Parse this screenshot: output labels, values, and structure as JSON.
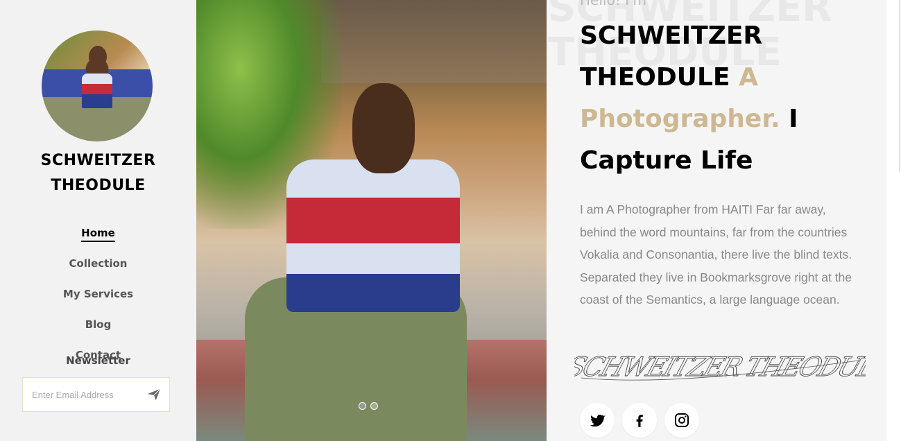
{
  "sidebar": {
    "site_name": "SCHWEITZER THEODULE",
    "nav": [
      {
        "label": "Home",
        "active": true
      },
      {
        "label": "Collection",
        "active": false
      },
      {
        "label": "My Services",
        "active": false
      },
      {
        "label": "Blog",
        "active": false
      },
      {
        "label": "Contact",
        "active": false
      }
    ],
    "newsletter": {
      "title": "Newsletter",
      "placeholder": "Enter Email Address",
      "submit_icon": "paper-plane-icon"
    }
  },
  "hero": {
    "slides": 2,
    "active_slide": 1
  },
  "intro": {
    "watermark": "SCHWEITZER THEODULE",
    "greeting": "Hello! I'm",
    "name": "SCHWEITZER THEODULE",
    "role": "A Photographer.",
    "tagline": "I Capture Life",
    "bio": "I am A Photographer from HAITI Far far away, behind the word mountains, far from the countries Vokalia and Consonantia, there live the blind texts. Separated they live in Bookmarksgrove right at the coast of the Semantics, a large language ocean.",
    "signature": "SCHWEITZER THEODULE",
    "social": [
      {
        "name": "twitter-icon"
      },
      {
        "name": "facebook-icon"
      },
      {
        "name": "instagram-icon"
      }
    ]
  },
  "colors": {
    "accent": "#cdb892",
    "sidebar_bg": "#f2f2f2",
    "panel_bg": "#f5f5f5",
    "text_muted": "#888888"
  }
}
